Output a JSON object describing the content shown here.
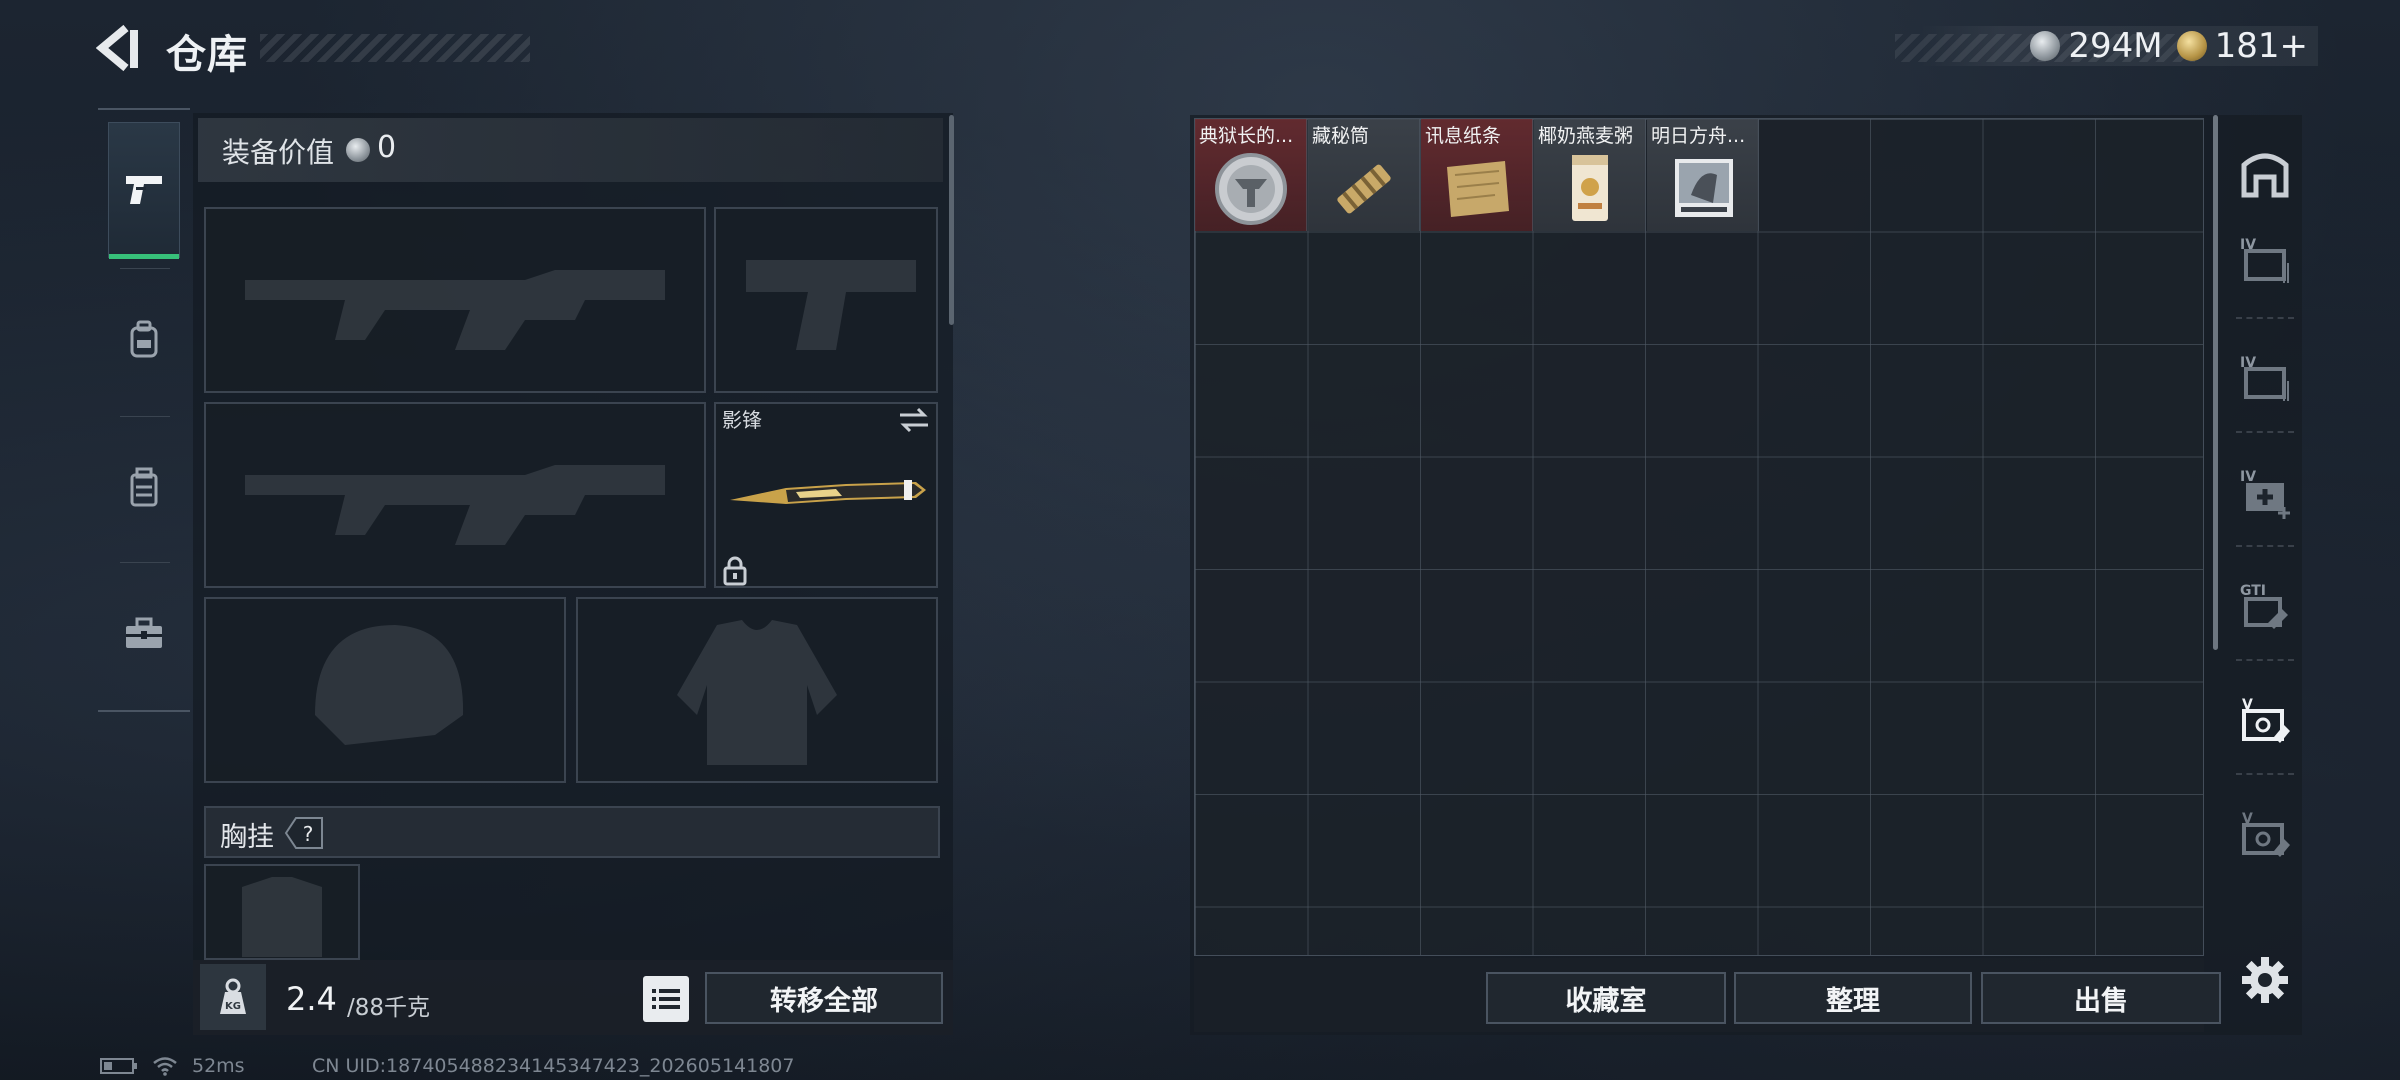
{
  "header": {
    "title": "仓库",
    "currencies": [
      {
        "icon": "silver-coin-icon",
        "value": "294M"
      },
      {
        "icon": "gold-coin-icon",
        "value": "181+"
      }
    ]
  },
  "categories": [
    {
      "name": "pistol-icon",
      "active": true
    },
    {
      "name": "backpack-icon",
      "active": false
    },
    {
      "name": "vest-icon",
      "active": false
    },
    {
      "name": "toolbox-icon",
      "active": false
    }
  ],
  "equipment": {
    "value_label": "装备价值",
    "value": "0",
    "knife_name": "影锋",
    "chest_label": "胸挂",
    "chest_help": "?"
  },
  "weight": {
    "current": "2.4",
    "max": "/88千克"
  },
  "buttons": {
    "transfer_all": "转移全部",
    "collection": "收藏室",
    "sort": "整理",
    "sell": "出售"
  },
  "items": [
    {
      "name": "典狱长的...",
      "rarity": "red"
    },
    {
      "name": "藏秘筒",
      "rarity": "gray"
    },
    {
      "name": "讯息纸条",
      "rarity": "red"
    },
    {
      "name": "椰奶燕麦粥",
      "rarity": "gray"
    },
    {
      "name": "明日方舟...",
      "rarity": "gray"
    }
  ],
  "rail": [
    "container-icon",
    "case-iv-icon",
    "case-iv-2-icon",
    "medkit-iv-icon",
    "gti-case-icon",
    "case-v-icon",
    "case-v-2-icon",
    "settings-icon"
  ],
  "status": {
    "ping": "52ms",
    "uid": "CN UID:187405488234145347423_202605141807"
  },
  "colors": {
    "active_tab_accent": "#37c07a",
    "rare_item_bg": "#6e2c30"
  }
}
